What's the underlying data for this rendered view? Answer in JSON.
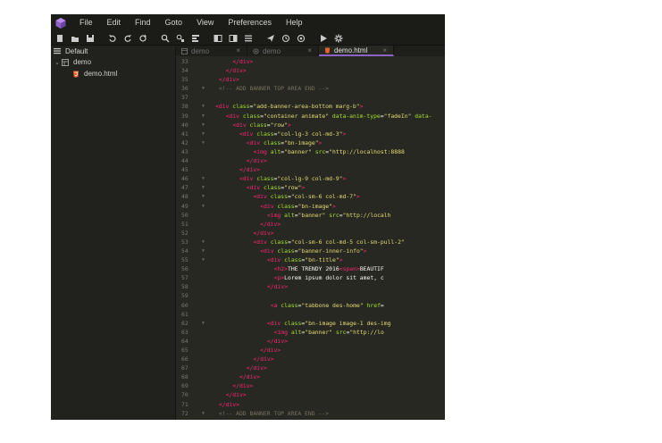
{
  "menu": [
    "File",
    "Edit",
    "Find",
    "Goto",
    "View",
    "Preferences",
    "Help"
  ],
  "colors": {
    "accent": "#8d62c6",
    "tag": "#f92672",
    "attr": "#a6e22e",
    "string": "#e6db74",
    "comment": "#75715e",
    "bg": "#272822"
  },
  "toolbar": [
    "new-file-icon",
    "open-folder-icon",
    "save-icon",
    "sep",
    "undo-icon",
    "redo-icon",
    "refresh-icon",
    "sep",
    "search-icon",
    "find-replace-icon",
    "format-icon",
    "sep",
    "split-left-icon",
    "split-right-icon",
    "list-icon",
    "sep",
    "send-icon",
    "history-icon",
    "plugin-icon",
    "sep",
    "run-icon",
    "gear-icon"
  ],
  "sidebar": {
    "project": "Default",
    "folder": "demo",
    "file": "demo.html"
  },
  "tabs": [
    {
      "label": "demo",
      "close": "×",
      "active": false
    },
    {
      "label": "demo",
      "close": "×",
      "active": false
    },
    {
      "label": "demo.html",
      "close": "×",
      "active": true
    }
  ],
  "editor": {
    "lines": [
      {
        "n": "33",
        "fold": false,
        "indent": 5,
        "toks": [
          [
            "t",
            "</div>"
          ]
        ]
      },
      {
        "n": "34",
        "fold": false,
        "indent": 3,
        "toks": [
          [
            "t",
            "</div>"
          ]
        ]
      },
      {
        "n": "35",
        "fold": false,
        "indent": 1,
        "toks": [
          [
            "t",
            "</div>"
          ]
        ]
      },
      {
        "n": "36",
        "fold": true,
        "indent": 1,
        "toks": [
          [
            "c",
            "<!-- ADD BANNER TOP AREA END -->"
          ]
        ]
      },
      {
        "n": "37",
        "fold": false,
        "indent": 0,
        "toks": []
      },
      {
        "n": "38",
        "fold": true,
        "indent": 0,
        "toks": [
          [
            "t",
            "<div "
          ],
          [
            "a",
            "class"
          ],
          [
            "p",
            "="
          ],
          [
            "s",
            "\"add-banner-area-bottom marg-b\""
          ],
          [
            "t",
            ">"
          ]
        ]
      },
      {
        "n": "39",
        "fold": true,
        "indent": 3,
        "toks": [
          [
            "t",
            "<div "
          ],
          [
            "a",
            "class"
          ],
          [
            "p",
            "="
          ],
          [
            "s",
            "\"container animate\""
          ],
          [
            "p",
            " "
          ],
          [
            "a",
            "data-anim-type"
          ],
          [
            "p",
            "="
          ],
          [
            "s",
            "\"fadeIn\""
          ],
          [
            "p",
            " "
          ],
          [
            "a",
            "data-"
          ]
        ]
      },
      {
        "n": "40",
        "fold": true,
        "indent": 5,
        "toks": [
          [
            "t",
            "<div "
          ],
          [
            "a",
            "class"
          ],
          [
            "p",
            "="
          ],
          [
            "s",
            "\"row\""
          ],
          [
            "t",
            ">"
          ]
        ]
      },
      {
        "n": "41",
        "fold": true,
        "indent": 7,
        "toks": [
          [
            "t",
            "<div "
          ],
          [
            "a",
            "class"
          ],
          [
            "p",
            "="
          ],
          [
            "s",
            "\"col-lg-3 col-md-3\""
          ],
          [
            "t",
            ">"
          ]
        ]
      },
      {
        "n": "42",
        "fold": true,
        "indent": 9,
        "toks": [
          [
            "t",
            "<div "
          ],
          [
            "a",
            "class"
          ],
          [
            "p",
            "="
          ],
          [
            "s",
            "\"bn-image\""
          ],
          [
            "t",
            ">"
          ]
        ]
      },
      {
        "n": "43",
        "fold": false,
        "indent": 11,
        "toks": [
          [
            "t",
            "<img "
          ],
          [
            "a",
            "alt"
          ],
          [
            "p",
            "="
          ],
          [
            "s",
            "\"banner\""
          ],
          [
            "p",
            " "
          ],
          [
            "a",
            "src"
          ],
          [
            "p",
            "="
          ],
          [
            "s",
            "\"http://localhost:8888"
          ]
        ]
      },
      {
        "n": "44",
        "fold": false,
        "indent": 9,
        "toks": [
          [
            "t",
            "</div>"
          ]
        ]
      },
      {
        "n": "45",
        "fold": false,
        "indent": 7,
        "toks": [
          [
            "t",
            "</div>"
          ]
        ]
      },
      {
        "n": "46",
        "fold": true,
        "indent": 7,
        "toks": [
          [
            "t",
            "<div "
          ],
          [
            "a",
            "class"
          ],
          [
            "p",
            "="
          ],
          [
            "s",
            "\"col-lg-9 col-md-9\""
          ],
          [
            "t",
            ">"
          ]
        ]
      },
      {
        "n": "47",
        "fold": true,
        "indent": 9,
        "toks": [
          [
            "t",
            "<div "
          ],
          [
            "a",
            "class"
          ],
          [
            "p",
            "="
          ],
          [
            "s",
            "\"row\""
          ],
          [
            "t",
            ">"
          ]
        ]
      },
      {
        "n": "48",
        "fold": true,
        "indent": 11,
        "toks": [
          [
            "t",
            "<div "
          ],
          [
            "a",
            "class"
          ],
          [
            "p",
            "="
          ],
          [
            "s",
            "\"col-sm-6 col-md-7\""
          ],
          [
            "t",
            ">"
          ]
        ]
      },
      {
        "n": "49",
        "fold": true,
        "indent": 13,
        "toks": [
          [
            "t",
            "<div "
          ],
          [
            "a",
            "class"
          ],
          [
            "p",
            "="
          ],
          [
            "s",
            "\"bn-image\""
          ],
          [
            "t",
            ">"
          ]
        ]
      },
      {
        "n": "50",
        "fold": false,
        "indent": 15,
        "toks": [
          [
            "t",
            "<img "
          ],
          [
            "a",
            "alt"
          ],
          [
            "p",
            "="
          ],
          [
            "s",
            "\"banner\""
          ],
          [
            "p",
            " "
          ],
          [
            "a",
            "src"
          ],
          [
            "p",
            "="
          ],
          [
            "s",
            "\"http://localh"
          ]
        ]
      },
      {
        "n": "51",
        "fold": false,
        "indent": 13,
        "toks": [
          [
            "t",
            "</div>"
          ]
        ]
      },
      {
        "n": "52",
        "fold": false,
        "indent": 11,
        "toks": [
          [
            "t",
            "</div>"
          ]
        ]
      },
      {
        "n": "53",
        "fold": true,
        "indent": 11,
        "toks": [
          [
            "t",
            "<div "
          ],
          [
            "a",
            "class"
          ],
          [
            "p",
            "="
          ],
          [
            "s",
            "\"col-sm-6 col-md-5 col-sm-pull-2\""
          ]
        ]
      },
      {
        "n": "54",
        "fold": true,
        "indent": 13,
        "toks": [
          [
            "t",
            "<div "
          ],
          [
            "a",
            "class"
          ],
          [
            "p",
            "="
          ],
          [
            "s",
            "\"banner-inner-info\""
          ],
          [
            "t",
            ">"
          ]
        ]
      },
      {
        "n": "55",
        "fold": true,
        "indent": 15,
        "toks": [
          [
            "t",
            "<div "
          ],
          [
            "a",
            "class"
          ],
          [
            "p",
            "="
          ],
          [
            "s",
            "\"bn-title\""
          ],
          [
            "t",
            ">"
          ]
        ]
      },
      {
        "n": "56",
        "fold": false,
        "indent": 17,
        "toks": [
          [
            "t",
            "<h2>"
          ],
          [
            "p",
            "THE TRENDY 2016"
          ],
          [
            "t",
            "<span>"
          ],
          [
            "p",
            "BEAUTIF"
          ]
        ]
      },
      {
        "n": "57",
        "fold": false,
        "indent": 17,
        "toks": [
          [
            "t",
            "<p>"
          ],
          [
            "p",
            "Lorem ipsum dolor sit amet, c"
          ]
        ]
      },
      {
        "n": "58",
        "fold": false,
        "indent": 15,
        "toks": [
          [
            "t",
            "</div>"
          ]
        ]
      },
      {
        "n": "59",
        "fold": false,
        "indent": 0,
        "toks": []
      },
      {
        "n": "60",
        "fold": false,
        "indent": 16,
        "toks": [
          [
            "t",
            "<a "
          ],
          [
            "a",
            "class"
          ],
          [
            "p",
            "="
          ],
          [
            "s",
            "\"tabbone des-home\""
          ],
          [
            "p",
            " "
          ],
          [
            "a",
            "href"
          ],
          [
            "p",
            "="
          ]
        ]
      },
      {
        "n": "61",
        "fold": false,
        "indent": 0,
        "toks": []
      },
      {
        "n": "62",
        "fold": true,
        "indent": 15,
        "toks": [
          [
            "t",
            "<div "
          ],
          [
            "a",
            "class"
          ],
          [
            "p",
            "="
          ],
          [
            "s",
            "\"bn-image image-1 des-img"
          ]
        ]
      },
      {
        "n": "63",
        "fold": false,
        "indent": 17,
        "toks": [
          [
            "t",
            "<img "
          ],
          [
            "a",
            "alt"
          ],
          [
            "p",
            "="
          ],
          [
            "s",
            "\"banner\""
          ],
          [
            "p",
            " "
          ],
          [
            "a",
            "src"
          ],
          [
            "p",
            "="
          ],
          [
            "s",
            "\"http://lo"
          ]
        ]
      },
      {
        "n": "64",
        "fold": false,
        "indent": 15,
        "toks": [
          [
            "t",
            "</div>"
          ]
        ]
      },
      {
        "n": "65",
        "fold": false,
        "indent": 13,
        "toks": [
          [
            "t",
            "</div>"
          ]
        ]
      },
      {
        "n": "66",
        "fold": false,
        "indent": 11,
        "toks": [
          [
            "t",
            "</div>"
          ]
        ]
      },
      {
        "n": "67",
        "fold": false,
        "indent": 9,
        "toks": [
          [
            "t",
            "</div>"
          ]
        ]
      },
      {
        "n": "68",
        "fold": false,
        "indent": 7,
        "toks": [
          [
            "t",
            "</div>"
          ]
        ]
      },
      {
        "n": "69",
        "fold": false,
        "indent": 5,
        "toks": [
          [
            "t",
            "</div>"
          ]
        ]
      },
      {
        "n": "70",
        "fold": false,
        "indent": 3,
        "toks": [
          [
            "t",
            "</div>"
          ]
        ]
      },
      {
        "n": "71",
        "fold": false,
        "indent": 1,
        "toks": [
          [
            "t",
            "</div>"
          ]
        ]
      },
      {
        "n": "72",
        "fold": true,
        "indent": 1,
        "toks": [
          [
            "c",
            "<!-- ADD BANNER TOP AREA END -->"
          ]
        ]
      }
    ]
  }
}
